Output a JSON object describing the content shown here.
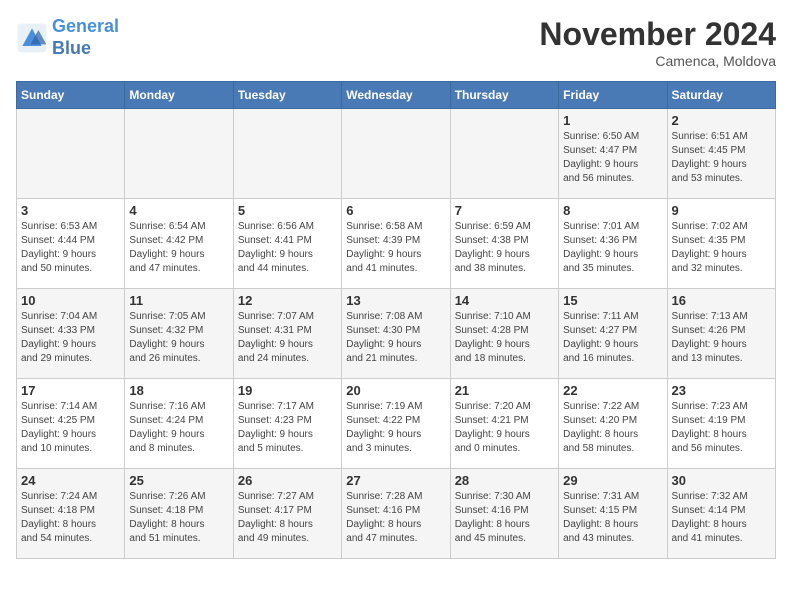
{
  "logo": {
    "line1": "General",
    "line2": "Blue"
  },
  "title": "November 2024",
  "subtitle": "Camenca, Moldova",
  "headers": [
    "Sunday",
    "Monday",
    "Tuesday",
    "Wednesday",
    "Thursday",
    "Friday",
    "Saturday"
  ],
  "weeks": [
    [
      {
        "day": "",
        "detail": ""
      },
      {
        "day": "",
        "detail": ""
      },
      {
        "day": "",
        "detail": ""
      },
      {
        "day": "",
        "detail": ""
      },
      {
        "day": "",
        "detail": ""
      },
      {
        "day": "1",
        "detail": "Sunrise: 6:50 AM\nSunset: 4:47 PM\nDaylight: 9 hours\nand 56 minutes."
      },
      {
        "day": "2",
        "detail": "Sunrise: 6:51 AM\nSunset: 4:45 PM\nDaylight: 9 hours\nand 53 minutes."
      }
    ],
    [
      {
        "day": "3",
        "detail": "Sunrise: 6:53 AM\nSunset: 4:44 PM\nDaylight: 9 hours\nand 50 minutes."
      },
      {
        "day": "4",
        "detail": "Sunrise: 6:54 AM\nSunset: 4:42 PM\nDaylight: 9 hours\nand 47 minutes."
      },
      {
        "day": "5",
        "detail": "Sunrise: 6:56 AM\nSunset: 4:41 PM\nDaylight: 9 hours\nand 44 minutes."
      },
      {
        "day": "6",
        "detail": "Sunrise: 6:58 AM\nSunset: 4:39 PM\nDaylight: 9 hours\nand 41 minutes."
      },
      {
        "day": "7",
        "detail": "Sunrise: 6:59 AM\nSunset: 4:38 PM\nDaylight: 9 hours\nand 38 minutes."
      },
      {
        "day": "8",
        "detail": "Sunrise: 7:01 AM\nSunset: 4:36 PM\nDaylight: 9 hours\nand 35 minutes."
      },
      {
        "day": "9",
        "detail": "Sunrise: 7:02 AM\nSunset: 4:35 PM\nDaylight: 9 hours\nand 32 minutes."
      }
    ],
    [
      {
        "day": "10",
        "detail": "Sunrise: 7:04 AM\nSunset: 4:33 PM\nDaylight: 9 hours\nand 29 minutes."
      },
      {
        "day": "11",
        "detail": "Sunrise: 7:05 AM\nSunset: 4:32 PM\nDaylight: 9 hours\nand 26 minutes."
      },
      {
        "day": "12",
        "detail": "Sunrise: 7:07 AM\nSunset: 4:31 PM\nDaylight: 9 hours\nand 24 minutes."
      },
      {
        "day": "13",
        "detail": "Sunrise: 7:08 AM\nSunset: 4:30 PM\nDaylight: 9 hours\nand 21 minutes."
      },
      {
        "day": "14",
        "detail": "Sunrise: 7:10 AM\nSunset: 4:28 PM\nDaylight: 9 hours\nand 18 minutes."
      },
      {
        "day": "15",
        "detail": "Sunrise: 7:11 AM\nSunset: 4:27 PM\nDaylight: 9 hours\nand 16 minutes."
      },
      {
        "day": "16",
        "detail": "Sunrise: 7:13 AM\nSunset: 4:26 PM\nDaylight: 9 hours\nand 13 minutes."
      }
    ],
    [
      {
        "day": "17",
        "detail": "Sunrise: 7:14 AM\nSunset: 4:25 PM\nDaylight: 9 hours\nand 10 minutes."
      },
      {
        "day": "18",
        "detail": "Sunrise: 7:16 AM\nSunset: 4:24 PM\nDaylight: 9 hours\nand 8 minutes."
      },
      {
        "day": "19",
        "detail": "Sunrise: 7:17 AM\nSunset: 4:23 PM\nDaylight: 9 hours\nand 5 minutes."
      },
      {
        "day": "20",
        "detail": "Sunrise: 7:19 AM\nSunset: 4:22 PM\nDaylight: 9 hours\nand 3 minutes."
      },
      {
        "day": "21",
        "detail": "Sunrise: 7:20 AM\nSunset: 4:21 PM\nDaylight: 9 hours\nand 0 minutes."
      },
      {
        "day": "22",
        "detail": "Sunrise: 7:22 AM\nSunset: 4:20 PM\nDaylight: 8 hours\nand 58 minutes."
      },
      {
        "day": "23",
        "detail": "Sunrise: 7:23 AM\nSunset: 4:19 PM\nDaylight: 8 hours\nand 56 minutes."
      }
    ],
    [
      {
        "day": "24",
        "detail": "Sunrise: 7:24 AM\nSunset: 4:18 PM\nDaylight: 8 hours\nand 54 minutes."
      },
      {
        "day": "25",
        "detail": "Sunrise: 7:26 AM\nSunset: 4:18 PM\nDaylight: 8 hours\nand 51 minutes."
      },
      {
        "day": "26",
        "detail": "Sunrise: 7:27 AM\nSunset: 4:17 PM\nDaylight: 8 hours\nand 49 minutes."
      },
      {
        "day": "27",
        "detail": "Sunrise: 7:28 AM\nSunset: 4:16 PM\nDaylight: 8 hours\nand 47 minutes."
      },
      {
        "day": "28",
        "detail": "Sunrise: 7:30 AM\nSunset: 4:16 PM\nDaylight: 8 hours\nand 45 minutes."
      },
      {
        "day": "29",
        "detail": "Sunrise: 7:31 AM\nSunset: 4:15 PM\nDaylight: 8 hours\nand 43 minutes."
      },
      {
        "day": "30",
        "detail": "Sunrise: 7:32 AM\nSunset: 4:14 PM\nDaylight: 8 hours\nand 41 minutes."
      }
    ]
  ]
}
